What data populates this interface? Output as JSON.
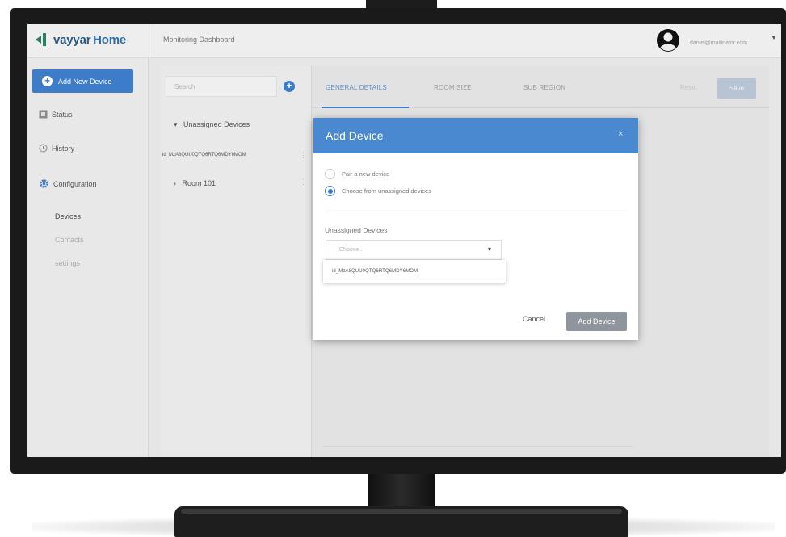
{
  "app": {
    "logo_name": "vayyar",
    "logo_suffix": "Home",
    "page_title": "Monitoring Dashboard",
    "user_email": "daniel@mailinator.com"
  },
  "sidebar": {
    "add_new_label": "Add New Device",
    "items": [
      {
        "label": "Status",
        "icon": "status-icon"
      },
      {
        "label": "History",
        "icon": "history-icon"
      },
      {
        "label": "Configuration",
        "icon": "gear-icon"
      }
    ],
    "sub_items": [
      {
        "label": "Devices"
      },
      {
        "label": "Contacts"
      },
      {
        "label": "settings"
      }
    ]
  },
  "tree": {
    "search_placeholder": "Search",
    "rows": [
      {
        "label": "Unassigned Devices",
        "prefix": "▾"
      },
      {
        "label": "id_MzA8QUU0QTQ6RTQ6MDY6MOM",
        "prefix": ""
      },
      {
        "label": "Room 101",
        "prefix": "›"
      }
    ]
  },
  "tabs": {
    "items": [
      {
        "label": "GENERAL DETAILS",
        "active": true
      },
      {
        "label": "ROOM SIZE",
        "active": false
      },
      {
        "label": "SUB REGION",
        "active": false
      }
    ],
    "reset_label": "Reset",
    "save_label": "Save"
  },
  "modal": {
    "title": "Add Device",
    "close": "×",
    "options": [
      {
        "label": "Pair a new device",
        "checked": false
      },
      {
        "label": "Choose from unassigned devices",
        "checked": true
      }
    ],
    "field_label": "Unassigned Devices",
    "select_placeholder": "Choose..",
    "dropdown_items": [
      "id_MzA8QUU0QTQ6RTQ6MDY6MOM"
    ],
    "cancel_label": "Cancel",
    "submit_label": "Add Device"
  },
  "colors": {
    "accent": "#3d7cc9",
    "modal_header": "#4a88d0",
    "brand_green": "#2a7d5f"
  }
}
